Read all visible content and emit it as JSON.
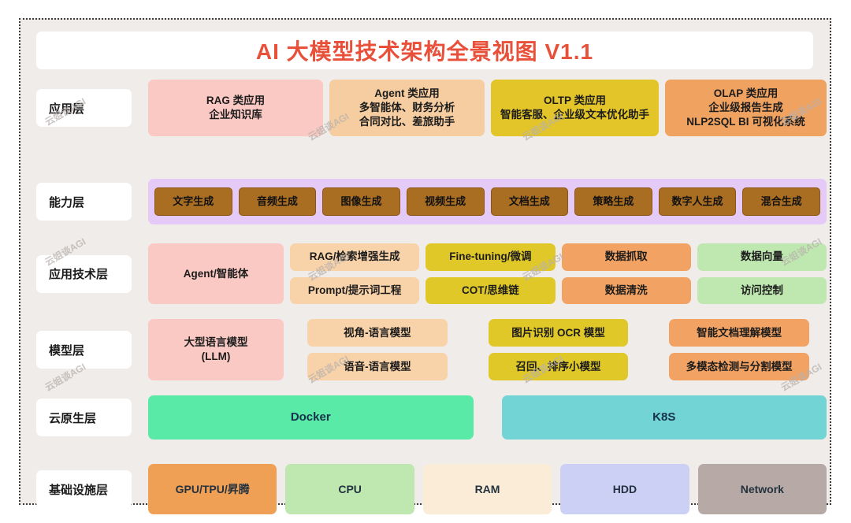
{
  "title": "AI 大模型技术架构全景视图 V1.1",
  "watermark": "云姐谈AGI",
  "layers": {
    "application": {
      "label": "应用层",
      "items": [
        {
          "name": "rag",
          "lines": [
            "RAG 类应用",
            "企业知识库"
          ],
          "color": "#fac9c4"
        },
        {
          "name": "agent",
          "lines": [
            "Agent 类应用",
            "多智能体、财务分析",
            "合同对比、差旅助手"
          ],
          "color": "#f6cda0"
        },
        {
          "name": "oltp",
          "lines": [
            "OLTP 类应用",
            "智能客服、企业级文本优化助手"
          ],
          "color": "#e3c529"
        },
        {
          "name": "olap",
          "lines": [
            "OLAP 类应用",
            "企业级报告生成",
            "NLP2SQL BI 可视化系统"
          ],
          "color": "#f0a261"
        }
      ]
    },
    "capability": {
      "label": "能力层",
      "container_color": "#e5caf8",
      "chip_color": "#a96e22",
      "items": [
        "文字生成",
        "音频生成",
        "图像生成",
        "视频生成",
        "文档生成",
        "策略生成",
        "数字人生成",
        "混合生成"
      ]
    },
    "app_tech": {
      "label": "应用技术层",
      "columns": [
        {
          "name": "agent-col",
          "color": "#fac9c4",
          "items": [
            "Agent/智能体"
          ]
        },
        {
          "name": "rag-prompt-col",
          "color": "#f8d2a8",
          "items": [
            "RAG/检索增强生成",
            "Prompt/提示词工程"
          ]
        },
        {
          "name": "finetune-cot-col",
          "color": "#e0c828",
          "items": [
            "Fine-tuning/微调",
            "COT/思维链"
          ]
        },
        {
          "name": "data-col",
          "color": "#f2a262",
          "items": [
            "数据抓取",
            "数据清洗"
          ]
        },
        {
          "name": "vector-access-col",
          "color": "#bfe8b0",
          "items": [
            "数据向量",
            "访问控制"
          ]
        }
      ]
    },
    "model": {
      "label": "模型层",
      "columns": [
        {
          "name": "llm-col",
          "color": "#fac9c4",
          "items": [
            "大型语言模型",
            "(LLM)"
          ],
          "merged": true
        },
        {
          "name": "vision-voice-col",
          "color": "#f8d2a8",
          "items": [
            "视角-语言模型",
            "语音-语言模型"
          ]
        },
        {
          "name": "ocr-rank-col",
          "color": "#e0c828",
          "items": [
            "图片识别 OCR 模型",
            "召回、排序小模型"
          ]
        },
        {
          "name": "doc-multimodal-col",
          "color": "#f2a262",
          "items": [
            "智能文档理解模型",
            "多模态检测与分割模型"
          ]
        }
      ]
    },
    "cloud_native": {
      "label": "云原生层",
      "items": [
        {
          "name": "docker",
          "label": "Docker",
          "color": "#5aeaa8"
        },
        {
          "name": "k8s",
          "label": "K8S",
          "color": "#72d4d4"
        }
      ]
    },
    "infrastructure": {
      "label": "基础设施层",
      "items": [
        {
          "name": "gpu",
          "label": "GPU/TPU/昇腾",
          "color": "#f0a055"
        },
        {
          "name": "cpu",
          "label": "CPU",
          "color": "#bfe8b0"
        },
        {
          "name": "ram",
          "label": "RAM",
          "color": "#faecd7"
        },
        {
          "name": "hdd",
          "label": "HDD",
          "color": "#ccd0f5"
        },
        {
          "name": "network",
          "label": "Network",
          "color": "#b7aaa6"
        }
      ]
    }
  },
  "colors": {
    "title_accent": "#e8503a",
    "board_background": "#efecea",
    "label_background": "#ffffff"
  }
}
